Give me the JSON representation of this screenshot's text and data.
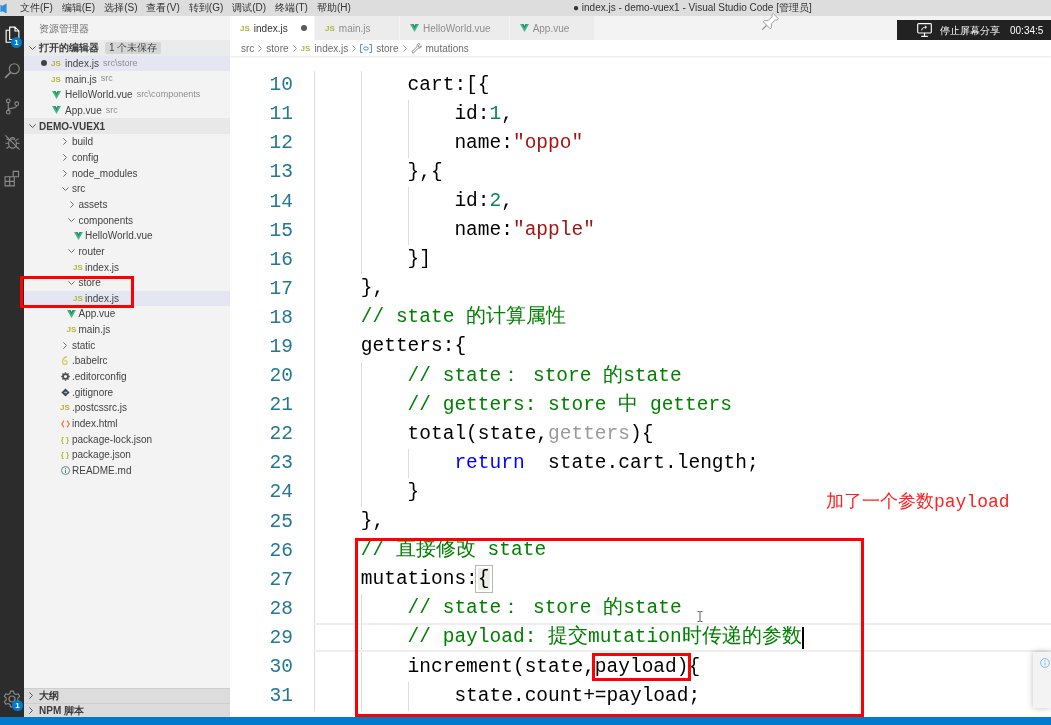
{
  "title_bar": {
    "menus": [
      "文件(F)",
      "编辑(E)",
      "选择(S)",
      "查看(V)",
      "转到(G)",
      "调试(D)",
      "终端(T)",
      "帮助(H)"
    ],
    "title": "● index.js - demo-vuex1 - Visual Studio Code [管理员]"
  },
  "activity_bar": {
    "items": [
      {
        "kind": "files",
        "selected": true,
        "badge": "1"
      },
      {
        "kind": "search",
        "selected": false
      },
      {
        "kind": "scm",
        "selected": false
      },
      {
        "kind": "debug",
        "selected": false
      },
      {
        "kind": "extensions",
        "selected": false
      }
    ],
    "manage": {
      "badge": "1"
    }
  },
  "sidebar": {
    "title": "资源管理器",
    "open_editors": {
      "title": "打开的编辑器",
      "expanded": true,
      "badge": "1 个未保存",
      "items": [
        {
          "name": "index.js",
          "path": "src\\store",
          "kind": "js",
          "icon_text": "JS",
          "dirty": true,
          "selected": true
        },
        {
          "name": "main.js",
          "path": "src",
          "kind": "js",
          "icon_text": "JS",
          "dirty": false,
          "selected": false
        },
        {
          "name": "HelloWorld.vue",
          "path": "src\\components",
          "kind": "vue",
          "dirty": false,
          "selected": false
        },
        {
          "name": "App.vue",
          "path": "src",
          "kind": "vue",
          "dirty": false,
          "selected": false
        }
      ]
    },
    "project": {
      "title": "DEMO-VUEX1",
      "expanded": true,
      "tree": [
        {
          "name": "build",
          "kind": "folder",
          "expanded": false,
          "selected": false
        },
        {
          "name": "config",
          "kind": "folder",
          "expanded": false,
          "selected": false
        },
        {
          "name": "node_modules",
          "kind": "folder",
          "expanded": false,
          "selected": false
        },
        {
          "name": "src",
          "kind": "folder",
          "expanded": true,
          "selected": false,
          "children": [
            {
              "name": "assets",
              "kind": "folder",
              "expanded": false,
              "selected": false
            },
            {
              "name": "components",
              "kind": "folder",
              "expanded": true,
              "selected": false,
              "children": [
                {
                  "name": "HelloWorld.vue",
                  "kind": "vue",
                  "selected": false
                }
              ]
            },
            {
              "name": "router",
              "kind": "folder",
              "expanded": true,
              "selected": false,
              "children": [
                {
                  "name": "index.js",
                  "kind": "js",
                  "icon_text": "JS",
                  "selected": false
                }
              ]
            },
            {
              "name": "store",
              "kind": "folder",
              "expanded": true,
              "selected": false,
              "outlined": true,
              "children": [
                {
                  "name": "index.js",
                  "kind": "js",
                  "icon_text": "JS",
                  "selected": true
                }
              ]
            },
            {
              "name": "App.vue",
              "kind": "vue",
              "selected": false
            },
            {
              "name": "main.js",
              "kind": "js",
              "icon_text": "JS",
              "selected": false
            }
          ]
        },
        {
          "name": "static",
          "kind": "folder",
          "expanded": false,
          "selected": false
        },
        {
          "name": ".babelrc",
          "kind": "babel",
          "selected": false
        },
        {
          "name": ".editorconfig",
          "kind": "config",
          "selected": false
        },
        {
          "name": ".gitignore",
          "kind": "git",
          "selected": false
        },
        {
          "name": ".postcssrc.js",
          "kind": "js",
          "icon_text": "JS",
          "selected": false
        },
        {
          "name": "index.html",
          "kind": "html",
          "selected": false
        },
        {
          "name": "package-lock.json",
          "kind": "json",
          "icon_text": "{ }",
          "selected": false
        },
        {
          "name": "package.json",
          "kind": "json",
          "icon_text": "{ }",
          "selected": false
        },
        {
          "name": "README.md",
          "kind": "info",
          "selected": false
        }
      ]
    },
    "panels": [
      {
        "title": "大纲",
        "expanded": false
      },
      {
        "title": "NPM 脚本",
        "expanded": false
      }
    ]
  },
  "tabs": [
    {
      "label": "index.js",
      "kind": "js",
      "icon_text": "JS",
      "selected": true,
      "dirty": true
    },
    {
      "label": "main.js",
      "kind": "js",
      "icon_text": "JS",
      "selected": false,
      "dirty": false
    },
    {
      "label": "HelloWorld.vue",
      "kind": "vue",
      "selected": false,
      "dirty": false
    },
    {
      "label": "App.vue",
      "kind": "vue",
      "selected": false,
      "dirty": false
    }
  ],
  "breadcrumbs": [
    {
      "label": "src",
      "kind": "folder"
    },
    {
      "label": "store",
      "kind": "folder"
    },
    {
      "label": "index.js",
      "kind": "js",
      "icon_text": "JS"
    },
    {
      "label": "store",
      "kind": "symbol"
    },
    {
      "label": "mutations",
      "kind": "method"
    }
  ],
  "editor": {
    "blocks": [
      {
        "lines": [
          {
            "number": "10",
            "kind": "code",
            "tokens": [
              {
                "text": "        cart:[{",
                "kind": "plain"
              }
            ]
          },
          {
            "number": "11",
            "kind": "code",
            "tokens": [
              {
                "text": "            id:",
                "kind": "plain"
              },
              {
                "text": "1",
                "kind": "number"
              },
              {
                "text": ",",
                "kind": "plain"
              }
            ]
          },
          {
            "number": "12",
            "kind": "code",
            "tokens": [
              {
                "text": "            name:",
                "kind": "plain"
              },
              {
                "text": "\"oppo\"",
                "kind": "string"
              }
            ]
          },
          {
            "number": "13",
            "kind": "code",
            "tokens": [
              {
                "text": "        },{",
                "kind": "plain"
              }
            ]
          },
          {
            "number": "14",
            "kind": "code",
            "tokens": [
              {
                "text": "            id:",
                "kind": "plain"
              },
              {
                "text": "2",
                "kind": "number"
              },
              {
                "text": ",",
                "kind": "plain"
              }
            ]
          },
          {
            "number": "15",
            "kind": "code",
            "tokens": [
              {
                "text": "            name:",
                "kind": "plain"
              },
              {
                "text": "\"apple\"",
                "kind": "string"
              }
            ]
          },
          {
            "number": "16",
            "kind": "code",
            "tokens": [
              {
                "text": "        }]",
                "kind": "plain"
              }
            ]
          },
          {
            "number": "17",
            "kind": "code",
            "tokens": [
              {
                "text": "    },",
                "kind": "plain"
              }
            ]
          },
          {
            "number": "18",
            "kind": "code",
            "tokens": [
              {
                "text": "    // state 的计算属性",
                "kind": "comment"
              }
            ]
          },
          {
            "number": "19",
            "kind": "code",
            "tokens": [
              {
                "text": "    getters:{",
                "kind": "plain"
              }
            ]
          },
          {
            "number": "20",
            "kind": "code",
            "tokens": [
              {
                "text": "        // state： store 的state",
                "kind": "comment"
              }
            ]
          },
          {
            "number": "21",
            "kind": "code",
            "tokens": [
              {
                "text": "        // getters: store 中 getters",
                "kind": "comment"
              }
            ]
          },
          {
            "number": "22",
            "kind": "code",
            "tokens": [
              {
                "text": "        total(state,",
                "kind": "plain"
              },
              {
                "text": "getters",
                "kind": "unused"
              },
              {
                "text": "){",
                "kind": "plain"
              }
            ]
          },
          {
            "number": "23",
            "kind": "code",
            "tokens": [
              {
                "text": "            return",
                "kind": "keyword"
              },
              {
                "text": "  state.cart.length;",
                "kind": "plain"
              }
            ]
          },
          {
            "number": "24",
            "kind": "code",
            "tokens": [
              {
                "text": "        }",
                "kind": "plain"
              }
            ]
          },
          {
            "number": "25",
            "kind": "code",
            "tokens": [
              {
                "text": "    },",
                "kind": "plain"
              }
            ]
          }
        ]
      },
      {
        "outlined": true,
        "lines": [
          {
            "number": "26",
            "kind": "code",
            "tokens": [
              {
                "text": "    // 直接修改 state",
                "kind": "comment"
              }
            ]
          },
          {
            "number": "27",
            "kind": "code",
            "tokens": [
              {
                "text": "    mutations:",
                "kind": "plain"
              },
              {
                "text": "{",
                "kind": "bracket-match"
              }
            ]
          },
          {
            "number": "28",
            "kind": "code",
            "tokens": [
              {
                "text": "        // state： store 的state",
                "kind": "comment"
              }
            ]
          },
          {
            "number": "29",
            "kind": "cursor",
            "tokens": [
              {
                "text": "        // payload: 提交mutation时传递的参数",
                "kind": "comment"
              }
            ]
          },
          {
            "number": "30",
            "kind": "code",
            "tokens": [
              {
                "text": "        increment(state,",
                "kind": "plain"
              },
              {
                "text": "payload)",
                "kind": "boxed"
              },
              {
                "text": "{",
                "kind": "plain"
              }
            ]
          },
          {
            "number": "31",
            "kind": "code",
            "tokens": [
              {
                "text": "            state.count+=payload;",
                "kind": "plain"
              }
            ]
          }
        ]
      }
    ]
  },
  "annotation_note": "加了一个参数payload",
  "screen_share": {
    "label": "停止屏幕分享",
    "timer": "00:34:5"
  },
  "notification": {
    "kind": "info"
  }
}
